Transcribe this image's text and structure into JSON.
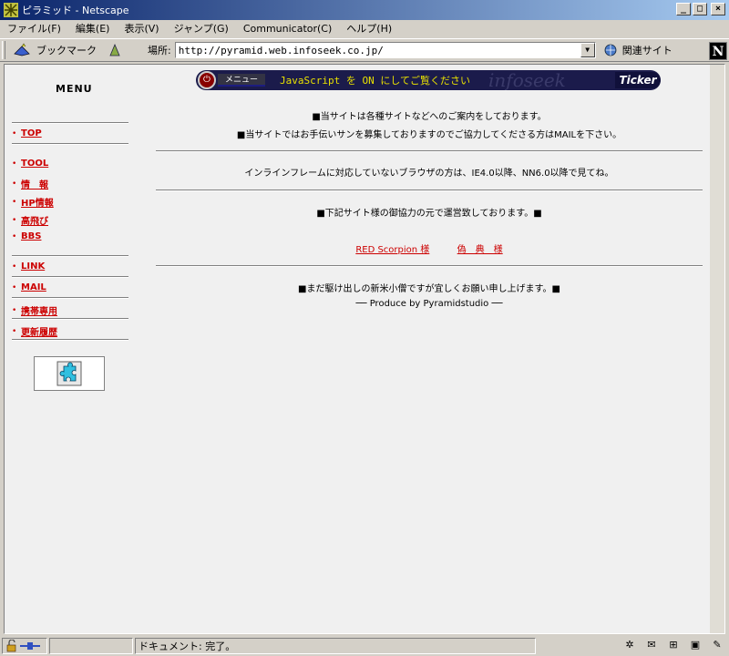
{
  "window": {
    "title": "ピラミッド - Netscape",
    "minimize": "_",
    "maximize": "□",
    "close": "×"
  },
  "menubar": [
    "ファイル(F)",
    "編集(E)",
    "表示(V)",
    "ジャンプ(G)",
    "Communicator(C)",
    "ヘルプ(H)"
  ],
  "toolbar": {
    "bookmarks": "ブックマーク",
    "location_label": "場所:",
    "url": "http://pyramid.web.infoseek.co.jp/",
    "related": "関連サイト",
    "logo": "N"
  },
  "sidebar": {
    "title": "MENU",
    "items": [
      "TOP",
      "TOOL",
      "情　報",
      "HP情報",
      "高飛び",
      "BBS",
      "LINK",
      "MAIL",
      "携帯専用",
      "更新履歴"
    ],
    "bullet": "•"
  },
  "banner": {
    "menu_label": "メニュー",
    "message": "JavaScript を ON にしてご覧ください",
    "brand": "infoseek",
    "ticker": "Ticker"
  },
  "main": {
    "intro1": "■当サイトは各種サイトなどへのご案内をしております。",
    "intro2": "■当サイトではお手伝いサンを募集しておりますのでご協力してくださる方はMAILを下さい。",
    "browser_note": "インラインフレームに対応していないブラウザの方は、IE4.0以降、NN6.0以降で見てね。",
    "partners_note": "■下記サイト様の御協力の元で運営致しております。■",
    "partner1": "RED Scorpion 様",
    "partner2": "偽　典　様",
    "closing": "■まだ駆け出しの新米小僧ですが宜しくお願い申し上げます。■",
    "credit": "── Produce by Pyramidstudio ──"
  },
  "statusbar": {
    "message": "ドキュメント: 完了。"
  },
  "colors": {
    "link": "#cc0000",
    "banner_bg": "#1b1b4b",
    "banner_text": "#e8e000",
    "titlebar": "#0a246a"
  }
}
